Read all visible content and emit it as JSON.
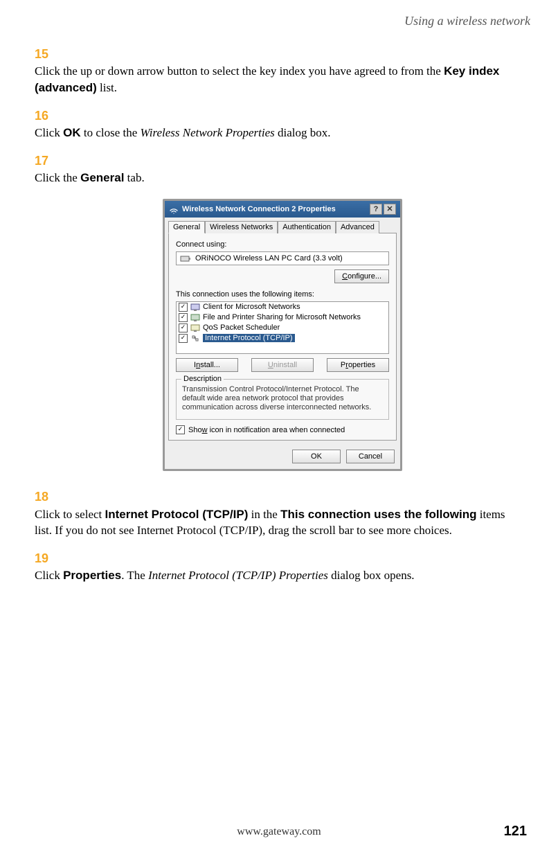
{
  "header": "Using a wireless network",
  "steps": {
    "s15": {
      "num": "15",
      "pre": "Click the up or down arrow button to select the key index you have agreed to from the ",
      "bold": "Key index (advanced)",
      "post": " list."
    },
    "s16": {
      "num": "16",
      "pre": "Click ",
      "bold": "OK",
      "mid": " to close the ",
      "italic": "Wireless Network Properties",
      "post": " dialog box."
    },
    "s17": {
      "num": "17",
      "pre": "Click the ",
      "bold": "General",
      "post": " tab."
    },
    "s18": {
      "num": "18",
      "pre": "Click to select ",
      "bold1": "Internet Protocol (TCP/IP)",
      "mid": " in the ",
      "bold2": "This connection uses the following",
      "post": " items list. If you do not see Internet Protocol (TCP/IP), drag the scroll bar to see more choices."
    },
    "s19": {
      "num": "19",
      "pre": "Click ",
      "bold": "Properties",
      "mid": ". The ",
      "italic": "Internet Protocol (TCP/IP) Properties",
      "post": " dialog box opens."
    }
  },
  "dialog": {
    "title": "Wireless Network Connection 2 Properties",
    "help": "?",
    "close": "✕",
    "tabs": [
      "General",
      "Wireless Networks",
      "Authentication",
      "Advanced"
    ],
    "connect_label": "Connect using:",
    "device": "ORiNOCO Wireless LAN PC Card (3.3 volt)",
    "configure": "Configure...",
    "items_label": "This connection uses the following items:",
    "items": [
      "Client for Microsoft Networks",
      "File and Printer Sharing for Microsoft Networks",
      "QoS Packet Scheduler",
      "Internet Protocol (TCP/IP)"
    ],
    "install": "Install...",
    "uninstall": "Uninstall",
    "properties": "Properties",
    "desc_legend": "Description",
    "description": "Transmission Control Protocol/Internet Protocol. The default wide area network protocol that provides communication across diverse interconnected networks.",
    "show_icon": "Show icon in notification area when connected",
    "ok": "OK",
    "cancel": "Cancel"
  },
  "footer_url": "www.gateway.com",
  "page_number": "121"
}
